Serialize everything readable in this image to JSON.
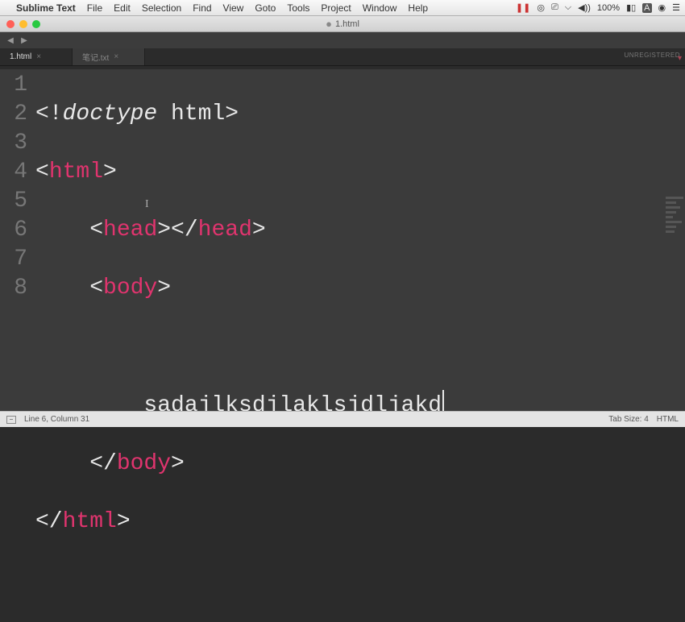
{
  "menubar": {
    "app_name": "Sublime Text",
    "items": [
      "File",
      "Edit",
      "Selection",
      "Find",
      "View",
      "Goto",
      "Tools",
      "Project",
      "Window",
      "Help"
    ],
    "right": {
      "pause": "❚❚",
      "battery": "100%",
      "time": ""
    }
  },
  "window": {
    "title": "1.html",
    "modified_indicator": "●"
  },
  "tabs": {
    "items": [
      {
        "label": "1.html",
        "active": true
      },
      {
        "label": "笔记.txt",
        "active": false
      }
    ],
    "unregistered": "UNREGISTERED"
  },
  "editor": {
    "lines": [
      1,
      2,
      3,
      4,
      5,
      6,
      7,
      8
    ],
    "l1": {
      "p1": "<!",
      "kw": "doctype",
      "sp": " ",
      "val": "html",
      "p2": ">"
    },
    "l2": {
      "p1": "<",
      "tag": "html",
      "p2": ">"
    },
    "l3": {
      "indent": "    ",
      "p1": "<",
      "t1": "head",
      "p2": "></",
      "t2": "head",
      "p3": ">"
    },
    "l4": {
      "indent": "    ",
      "p1": "<",
      "tag": "body",
      "p2": ">"
    },
    "l5": {
      "indent": "    "
    },
    "l6": {
      "indent": "        ",
      "text": "sadajlksdjlaklsjdljakd"
    },
    "l7": {
      "indent": "    ",
      "p1": "</",
      "tag": "body",
      "p2": ">"
    },
    "l8": {
      "p1": "</",
      "tag": "html",
      "p2": ">"
    }
  },
  "statusbar": {
    "position": "Line 6, Column 31",
    "tab_size": "Tab Size: 4",
    "syntax": "HTML"
  }
}
